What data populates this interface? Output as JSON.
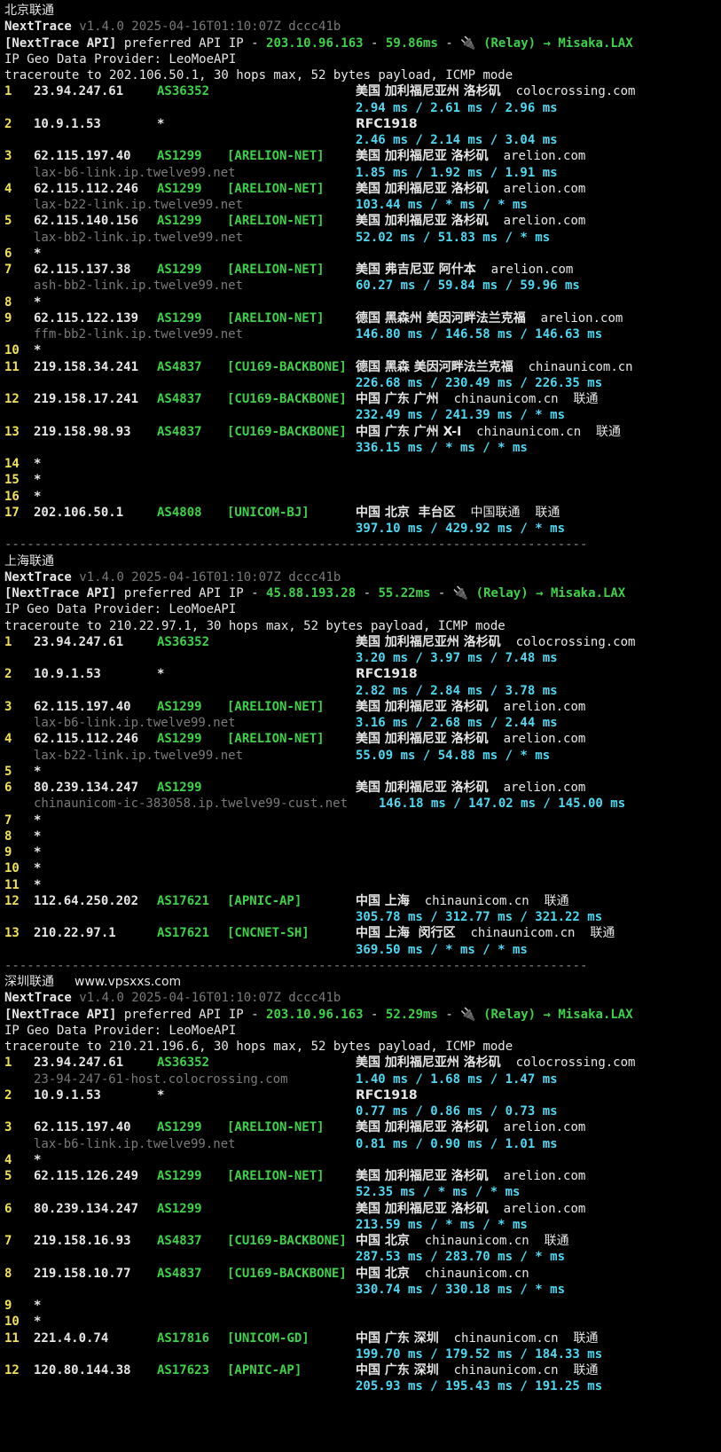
{
  "sections": [
    {
      "label": "北京联通",
      "url": "",
      "api": {
        "ip": "203.10.96.163",
        "latency": "59.86ms"
      },
      "target": "traceroute to 202.106.50.1, 30 hops max, 52 bytes payload, ICMP mode",
      "hops": [
        {
          "n": "1",
          "ip": "23.94.247.61",
          "as": "AS36352",
          "net": "",
          "geo": "美国 加利福尼亚州 洛杉矶",
          "domain": "colocrossing.com",
          "isp": "",
          "rdns": "",
          "rtt": "2.94 ms / 2.61 ms / 2.96 ms"
        },
        {
          "n": "2",
          "ip": "10.9.1.53",
          "as": "*",
          "net": "",
          "geo": "RFC1918",
          "domain": "",
          "isp": "",
          "rdns": "",
          "rtt": "2.46 ms / 2.14 ms / 3.04 ms"
        },
        {
          "n": "3",
          "ip": "62.115.197.40",
          "as": "AS1299",
          "net": "[ARELION-NET]",
          "geo": "美国 加利福尼亚 洛杉矶",
          "domain": "arelion.com",
          "isp": "",
          "rdns": "lax-b6-link.ip.twelve99.net",
          "rtt": "1.85 ms / 1.92 ms / 1.91 ms"
        },
        {
          "n": "4",
          "ip": "62.115.112.246",
          "as": "AS1299",
          "net": "[ARELION-NET]",
          "geo": "美国 加利福尼亚 洛杉矶",
          "domain": "arelion.com",
          "isp": "",
          "rdns": "lax-b22-link.ip.twelve99.net",
          "rtt": "103.44 ms / * ms / * ms"
        },
        {
          "n": "5",
          "ip": "62.115.140.156",
          "as": "AS1299",
          "net": "[ARELION-NET]",
          "geo": "美国 加利福尼亚 洛杉矶",
          "domain": "arelion.com",
          "isp": "",
          "rdns": "lax-bb2-link.ip.twelve99.net",
          "rtt": "52.02 ms / 51.83 ms / * ms"
        },
        {
          "n": "6",
          "ip": "*"
        },
        {
          "n": "7",
          "ip": "62.115.137.38",
          "as": "AS1299",
          "net": "[ARELION-NET]",
          "geo": "美国 弗吉尼亚 阿什本",
          "domain": "arelion.com",
          "isp": "",
          "rdns": "ash-bb2-link.ip.twelve99.net",
          "rtt": "60.27 ms / 59.84 ms / 59.96 ms"
        },
        {
          "n": "8",
          "ip": "*"
        },
        {
          "n": "9",
          "ip": "62.115.122.139",
          "as": "AS1299",
          "net": "[ARELION-NET]",
          "geo": "德国 黑森州 美因河畔法兰克福",
          "domain": "arelion.com",
          "isp": "",
          "rdns": "ffm-bb2-link.ip.twelve99.net",
          "rtt": "146.80 ms / 146.58 ms / 146.63 ms"
        },
        {
          "n": "10",
          "ip": "*"
        },
        {
          "n": "11",
          "ip": "219.158.34.241",
          "as": "AS4837",
          "net": "[CU169-BACKBONE]",
          "geo": "德国 黑森 美因河畔法兰克福",
          "domain": "chinaunicom.cn",
          "isp": "",
          "rdns": "",
          "rtt": "226.68 ms / 230.49 ms / 226.35 ms"
        },
        {
          "n": "12",
          "ip": "219.158.17.241",
          "as": "AS4837",
          "net": "[CU169-BACKBONE]",
          "geo": "中国 广东 广州",
          "domain": "chinaunicom.cn",
          "isp": "联通",
          "rdns": "",
          "rtt": "232.49 ms / 241.39 ms / * ms"
        },
        {
          "n": "13",
          "ip": "219.158.98.93",
          "as": "AS4837",
          "net": "[CU169-BACKBONE]",
          "geo": "中国 广东 广州 X-I",
          "domain": "chinaunicom.cn",
          "isp": "联通",
          "rdns": "",
          "rtt": "336.15 ms / * ms / * ms"
        },
        {
          "n": "14",
          "ip": "*"
        },
        {
          "n": "15",
          "ip": "*"
        },
        {
          "n": "16",
          "ip": "*"
        },
        {
          "n": "17",
          "ip": "202.106.50.1",
          "as": "AS4808",
          "net": "[UNICOM-BJ]",
          "geo": "中国 北京  丰台区",
          "domain": "中国联通",
          "isp": "联通",
          "rdns": "",
          "rtt": "397.10 ms / 429.92 ms / * ms"
        }
      ]
    },
    {
      "label": "上海联通",
      "url": "",
      "api": {
        "ip": "45.88.193.28",
        "latency": "55.22ms"
      },
      "target": "traceroute to 210.22.97.1, 30 hops max, 52 bytes payload, ICMP mode",
      "hops": [
        {
          "n": "1",
          "ip": "23.94.247.61",
          "as": "AS36352",
          "net": "",
          "geo": "美国 加利福尼亚州 洛杉矶",
          "domain": "colocrossing.com",
          "isp": "",
          "rdns": "",
          "rtt": "3.20 ms / 3.97 ms / 7.48 ms"
        },
        {
          "n": "2",
          "ip": "10.9.1.53",
          "as": "*",
          "net": "",
          "geo": "RFC1918",
          "domain": "",
          "isp": "",
          "rdns": "",
          "rtt": "2.82 ms / 2.84 ms / 3.78 ms"
        },
        {
          "n": "3",
          "ip": "62.115.197.40",
          "as": "AS1299",
          "net": "[ARELION-NET]",
          "geo": "美国 加利福尼亚 洛杉矶",
          "domain": "arelion.com",
          "isp": "",
          "rdns": "lax-b6-link.ip.twelve99.net",
          "rtt": "3.16 ms / 2.68 ms / 2.44 ms"
        },
        {
          "n": "4",
          "ip": "62.115.112.246",
          "as": "AS1299",
          "net": "[ARELION-NET]",
          "geo": "美国 加利福尼亚 洛杉矶",
          "domain": "arelion.com",
          "isp": "",
          "rdns": "lax-b22-link.ip.twelve99.net",
          "rtt": "55.09 ms / 54.88 ms / * ms"
        },
        {
          "n": "5",
          "ip": "*"
        },
        {
          "n": "6",
          "ip": "80.239.134.247",
          "as": "AS1299",
          "net": "",
          "geo": "美国 加利福尼亚 洛杉矶",
          "domain": "arelion.com",
          "isp": "",
          "rdns": "chinaunicom-ic-383058.ip.twelve99-cust.net",
          "rtt": "146.18 ms / 147.02 ms / 145.00 ms",
          "inline": true
        },
        {
          "n": "7",
          "ip": "*"
        },
        {
          "n": "8",
          "ip": "*"
        },
        {
          "n": "9",
          "ip": "*"
        },
        {
          "n": "10",
          "ip": "*"
        },
        {
          "n": "11",
          "ip": "*"
        },
        {
          "n": "12",
          "ip": "112.64.250.202",
          "as": "AS17621",
          "net": "[APNIC-AP]",
          "geo": "中国 上海",
          "domain": "chinaunicom.cn",
          "isp": "联通",
          "rdns": "",
          "rtt": "305.78 ms / 312.77 ms / 321.22 ms"
        },
        {
          "n": "13",
          "ip": "210.22.97.1",
          "as": "AS17621",
          "net": "[CNCNET-SH]",
          "geo": "中国 上海  闵行区",
          "domain": "chinaunicom.cn",
          "isp": "联通",
          "rdns": "",
          "rtt": "369.50 ms / * ms / * ms"
        }
      ]
    },
    {
      "label": "深圳联通",
      "url": "www.vpsxxs.com",
      "api": {
        "ip": "203.10.96.163",
        "latency": "52.29ms"
      },
      "target": "traceroute to 210.21.196.6, 30 hops max, 52 bytes payload, ICMP mode",
      "hops": [
        {
          "n": "1",
          "ip": "23.94.247.61",
          "as": "AS36352",
          "net": "",
          "geo": "美国 加利福尼亚州 洛杉矶",
          "domain": "colocrossing.com",
          "isp": "",
          "rdns": "23-94-247-61-host.colocrossing.com",
          "rtt": "1.40 ms / 1.68 ms / 1.47 ms"
        },
        {
          "n": "2",
          "ip": "10.9.1.53",
          "as": "*",
          "net": "",
          "geo": "RFC1918",
          "domain": "",
          "isp": "",
          "rdns": "",
          "rtt": "0.77 ms / 0.86 ms / 0.73 ms"
        },
        {
          "n": "3",
          "ip": "62.115.197.40",
          "as": "AS1299",
          "net": "[ARELION-NET]",
          "geo": "美国 加利福尼亚 洛杉矶",
          "domain": "arelion.com",
          "isp": "",
          "rdns": "lax-b6-link.ip.twelve99.net",
          "rtt": "0.81 ms / 0.90 ms / 1.01 ms"
        },
        {
          "n": "4",
          "ip": "*"
        },
        {
          "n": "5",
          "ip": "62.115.126.249",
          "as": "AS1299",
          "net": "[ARELION-NET]",
          "geo": "美国 加利福尼亚 洛杉矶",
          "domain": "arelion.com",
          "isp": "",
          "rdns": "",
          "rtt": "52.35 ms / * ms / * ms"
        },
        {
          "n": "6",
          "ip": "80.239.134.247",
          "as": "AS1299",
          "net": "",
          "geo": "美国 加利福尼亚 洛杉矶",
          "domain": "arelion.com",
          "isp": "",
          "rdns": "",
          "rtt": "213.59 ms / * ms / * ms"
        },
        {
          "n": "7",
          "ip": "219.158.16.93",
          "as": "AS4837",
          "net": "[CU169-BACKBONE]",
          "geo": "中国 北京",
          "domain": "chinaunicom.cn",
          "isp": "联通",
          "rdns": "",
          "rtt": "287.53 ms / 283.70 ms / * ms"
        },
        {
          "n": "8",
          "ip": "219.158.10.77",
          "as": "AS4837",
          "net": "[CU169-BACKBONE]",
          "geo": "中国 北京",
          "domain": "chinaunicom.cn",
          "isp": "",
          "rdns": "",
          "rtt": "330.74 ms / 330.18 ms / * ms"
        },
        {
          "n": "9",
          "ip": "*"
        },
        {
          "n": "10",
          "ip": "*"
        },
        {
          "n": "11",
          "ip": "221.4.0.74",
          "as": "AS17816",
          "net": "[UNICOM-GD]",
          "geo": "中国 广东 深圳",
          "domain": "chinaunicom.cn",
          "isp": "联通",
          "rdns": "",
          "rtt": "199.70 ms / 179.52 ms / 184.33 ms"
        },
        {
          "n": "12",
          "ip": "120.80.144.38",
          "as": "AS17623",
          "net": "[APNIC-AP]",
          "geo": "中国 广东 深圳",
          "domain": "chinaunicom.cn",
          "isp": "联通",
          "rdns": "",
          "rtt": "205.93 ms / 195.43 ms / 191.25 ms"
        }
      ]
    }
  ],
  "common": {
    "tool_name": "NextTrace",
    "version": "v1.4.0 2025-04-16T01:10:07Z dccc41b",
    "api_prefix": "[NextTrace API]",
    "api_text": " preferred API IP - ",
    "relay_text": "(Relay) → Misaka.LAX",
    "geo_provider": "IP Geo Data Provider: LeoMoeAPI",
    "separator": "------------------------------------------------------------------------------"
  },
  "colors": {
    "background": "#000000",
    "text": "#e6e6e6",
    "hop_number": "#f1e05a",
    "asn": "#3ed24a",
    "rtt": "#4fd8f2",
    "rdns": "#7a7a7a"
  },
  "icons": {
    "relay": "plug-icon"
  }
}
